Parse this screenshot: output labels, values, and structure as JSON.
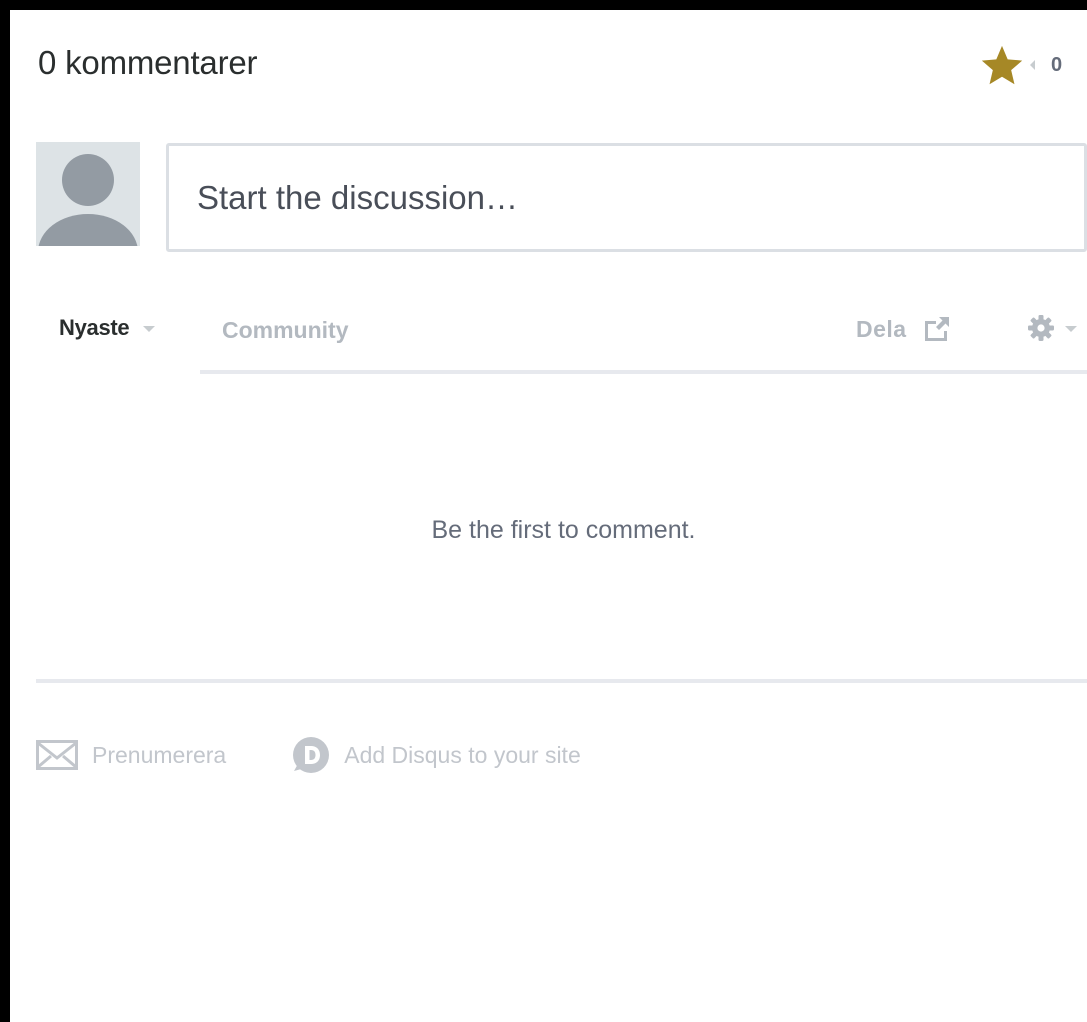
{
  "header": {
    "comment_count_label": "0 kommentarer",
    "recommend_count": "0"
  },
  "composer": {
    "placeholder": "Start the discussion…"
  },
  "nav": {
    "sort_label": "Nyaste",
    "community_label": "Community",
    "share_label": "Dela"
  },
  "empty_state": {
    "message": "Be the first to comment."
  },
  "footer": {
    "subscribe_label": "Prenumerera",
    "add_disqus_label": "Add Disqus to your site"
  },
  "icons": {
    "star": "star-icon",
    "avatar": "user-avatar-icon",
    "share": "share-icon",
    "settings": "gear-icon",
    "mail": "mail-icon",
    "disqus": "disqus-logo-icon"
  },
  "colors": {
    "star": "#a68826",
    "text_dark": "#2a2e2e",
    "muted": "#b3b9c0",
    "divider": "#e7e9ee",
    "avatar_bg": "#dde3e6",
    "avatar_fg": "#939ba3"
  }
}
